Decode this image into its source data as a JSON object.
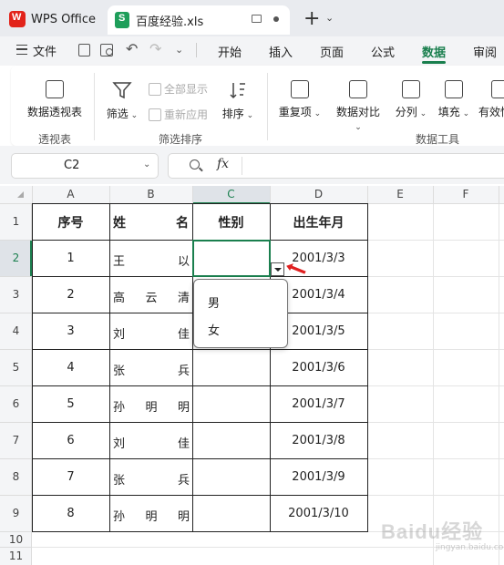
{
  "titlebar": {
    "app_name": "WPS Office",
    "file_name": "百度经验.xls",
    "new_tab_icon": "plus-icon"
  },
  "menubar": {
    "file_label": "文件",
    "tabs": [
      "开始",
      "插入",
      "页面",
      "公式",
      "数据",
      "审阅"
    ],
    "active_tab": "数据"
  },
  "ribbon": {
    "pivot_label": "数据透视表",
    "pivot_group": "透视表",
    "filter_label": "筛选",
    "show_all_label": "全部显示",
    "reapply_label": "重新应用",
    "sort_label": "排序",
    "filter_sort_group": "筛选排序",
    "duplicates_label": "重复项",
    "compare_label": "数据对比",
    "split_label": "分列",
    "fill_label": "填充",
    "valid_label": "有效性",
    "data_tools_group": "数据工具"
  },
  "formula_bar": {
    "name_box": "C2",
    "fx_label": "fx",
    "content": ""
  },
  "sheet": {
    "columns": [
      "A",
      "B",
      "C",
      "D",
      "E",
      "F"
    ],
    "rows": [
      "1",
      "2",
      "3",
      "4",
      "5",
      "6",
      "7",
      "8",
      "9",
      "10",
      "11"
    ],
    "selected_cell": "C2",
    "headers": {
      "seq": "序号",
      "surname": "姓",
      "given": "名",
      "gender": "性别",
      "birth": "出生年月"
    },
    "data": [
      {
        "seq": "1",
        "name": [
          "王",
          "以"
        ],
        "gender": "",
        "birth": "2001/3/3"
      },
      {
        "seq": "2",
        "name": [
          "高",
          "云",
          "清"
        ],
        "gender": "",
        "birth": "2001/3/4"
      },
      {
        "seq": "3",
        "name": [
          "刘",
          "佳"
        ],
        "gender": "",
        "birth": "2001/3/5"
      },
      {
        "seq": "4",
        "name": [
          "张",
          "兵"
        ],
        "gender": "",
        "birth": "2001/3/6"
      },
      {
        "seq": "5",
        "name": [
          "孙",
          "明",
          "明"
        ],
        "gender": "",
        "birth": "2001/3/7"
      },
      {
        "seq": "6",
        "name": [
          "刘",
          "佳"
        ],
        "gender": "",
        "birth": "2001/3/8"
      },
      {
        "seq": "7",
        "name": [
          "张",
          "兵"
        ],
        "gender": "",
        "birth": "2001/3/9"
      },
      {
        "seq": "8",
        "name": [
          "孙",
          "明",
          "明"
        ],
        "gender": "",
        "birth": "2001/3/10"
      }
    ]
  },
  "dropdown": {
    "options": [
      "男",
      "女"
    ]
  },
  "watermark": {
    "text": "Baidu经验",
    "sub": "jingyan.baidu.com"
  },
  "colors": {
    "accent": "#1a7f4e",
    "arrow": "#e02020"
  }
}
